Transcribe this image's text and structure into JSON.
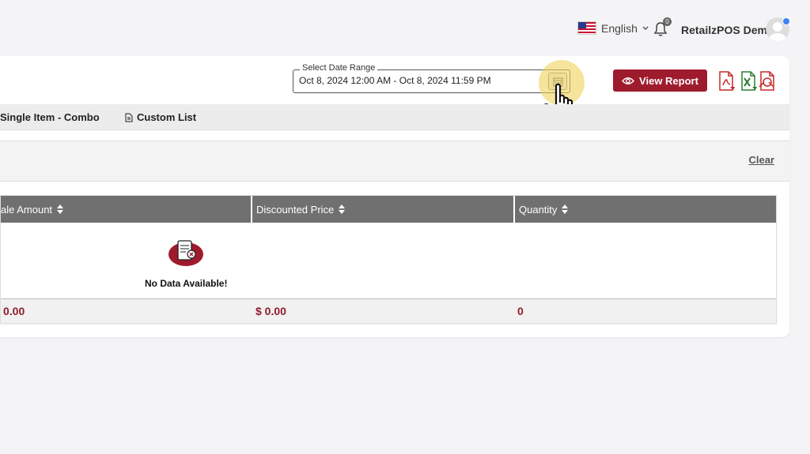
{
  "header": {
    "language": "English",
    "notification_count": "0",
    "username": "RetailzPOS Demo"
  },
  "report": {
    "date_range_label": "Select Date Range",
    "date_range_value": "Oct 8, 2024 12:00 AM - Oct 8, 2024 11:59 PM",
    "view_report_label": "View Report"
  },
  "tabs": [
    {
      "label": "Single Item - Combo"
    },
    {
      "label": "Custom List"
    }
  ],
  "filters": {
    "clear_label": "Clear"
  },
  "table": {
    "columns": [
      {
        "label": "ale Amount"
      },
      {
        "label": "Discounted Price"
      },
      {
        "label": "Quantity"
      }
    ],
    "empty_message": "No Data Available!",
    "totals": [
      "0.00",
      "$ 0.00",
      "0"
    ]
  },
  "colors": {
    "brand": "#9e1b2e",
    "header_gray": "#707070",
    "cursor_highlight": "#f0d25a"
  }
}
